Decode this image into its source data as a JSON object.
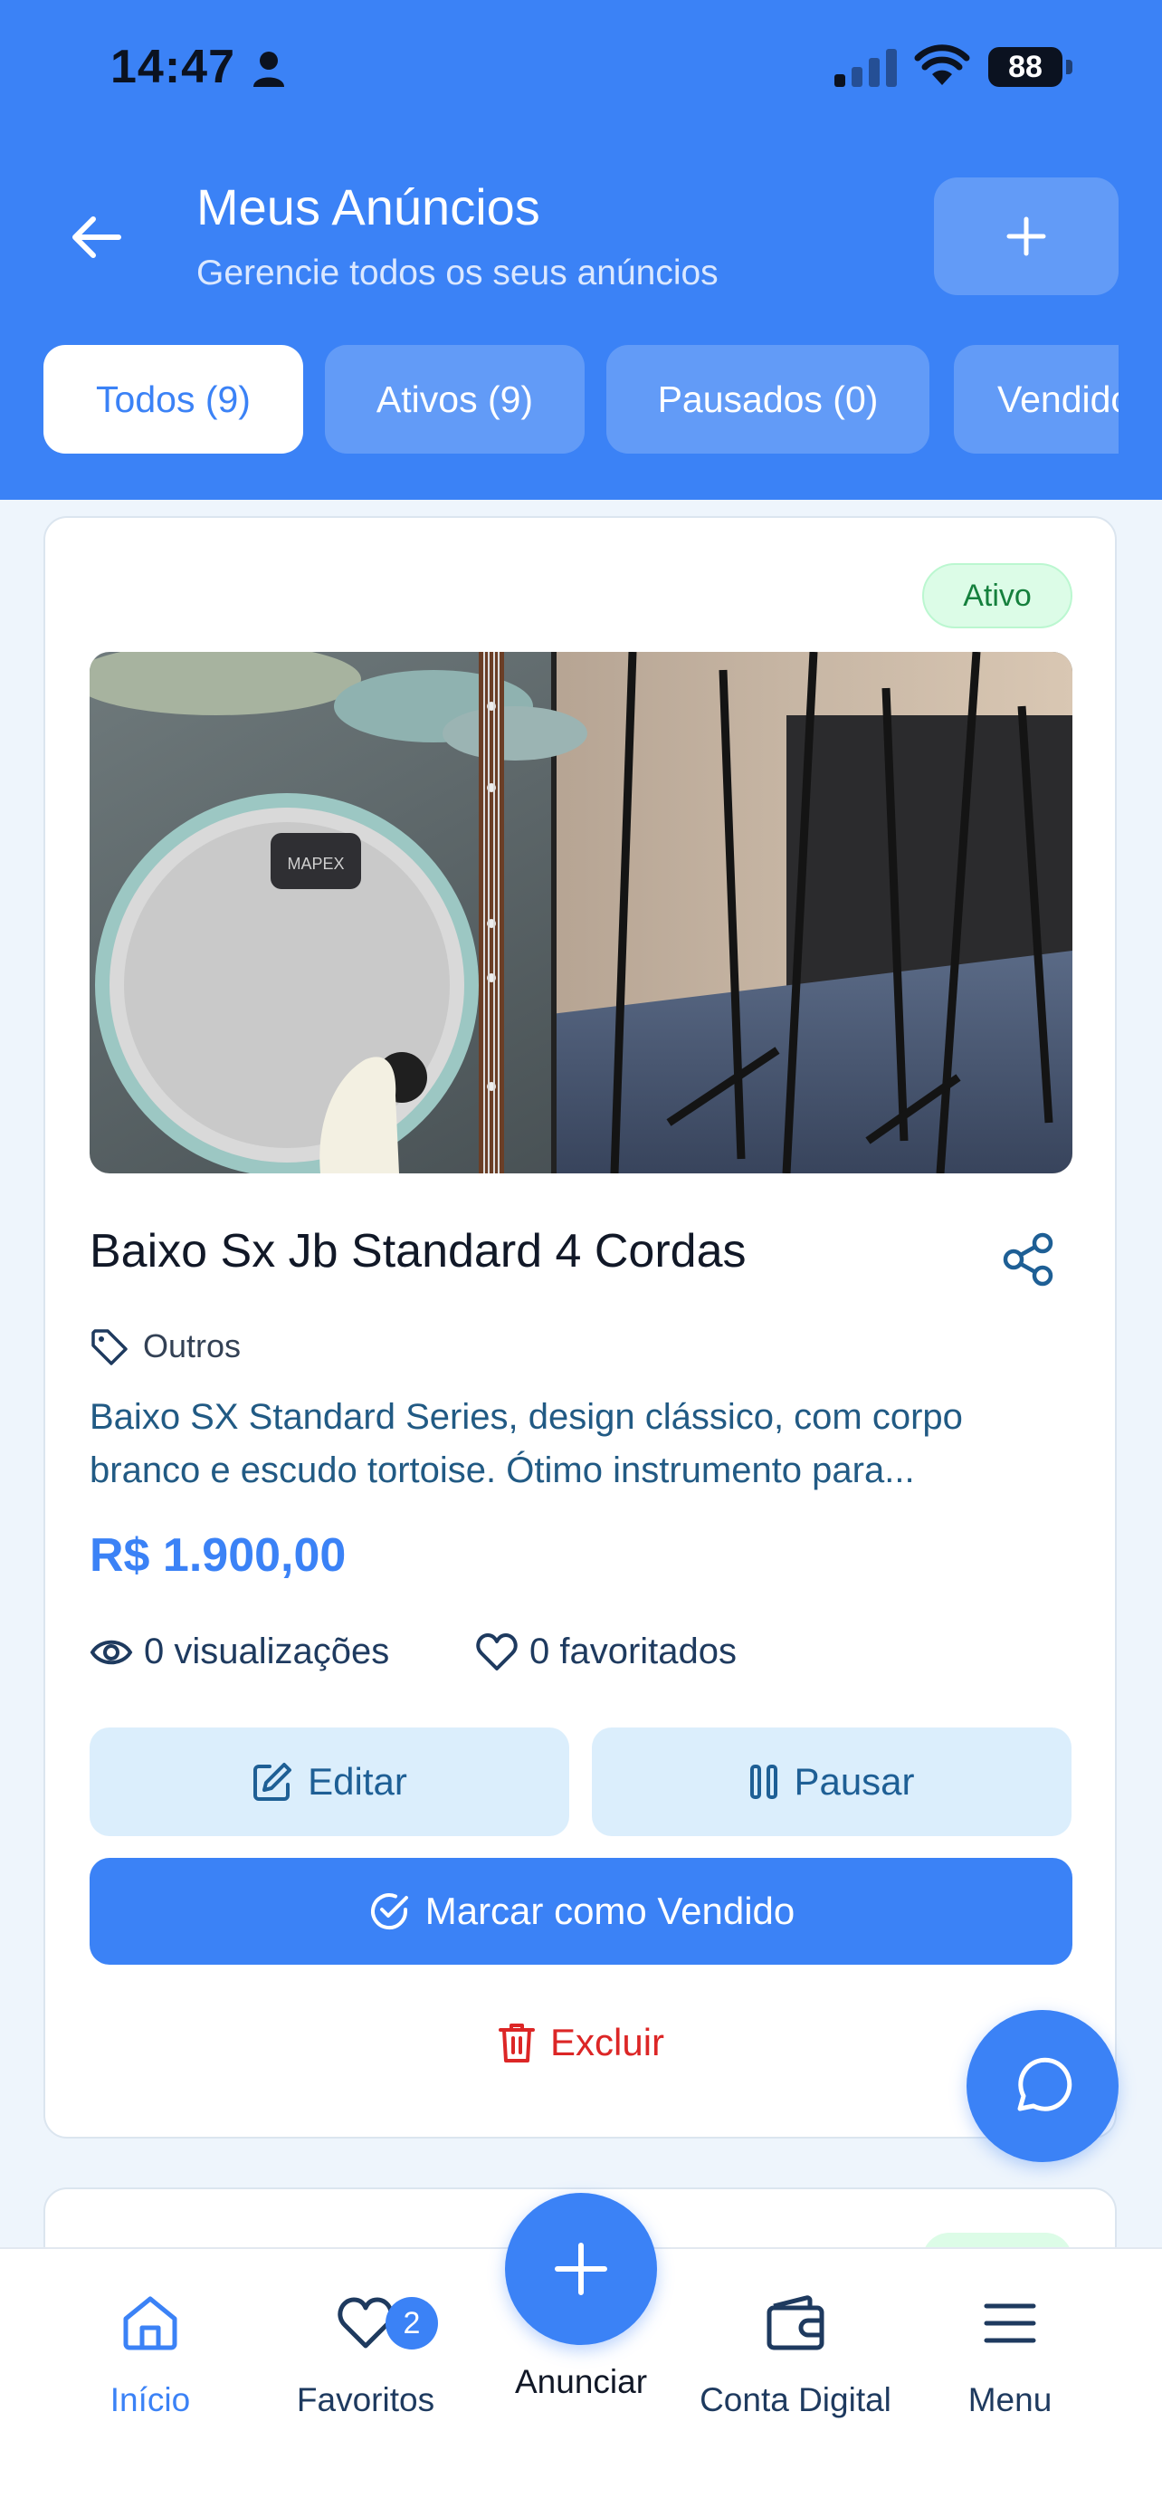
{
  "status_bar": {
    "time": "14:47",
    "battery": "88"
  },
  "header": {
    "title": "Meus Anúncios",
    "subtitle": "Gerencie todos os seus anúncios"
  },
  "tabs": [
    {
      "label": "Todos (9)",
      "active": true
    },
    {
      "label": "Ativos (9)",
      "active": false
    },
    {
      "label": "Pausados (0)",
      "active": false
    },
    {
      "label": "Vendidos",
      "active": false
    }
  ],
  "listing": {
    "status": "Ativo",
    "title": "Baixo Sx Jb Standard 4 Cordas",
    "category": "Outros",
    "description": "Baixo SX Standard Series, design clássico, com corpo branco e escudo tortoise. Ótimo instrumento para...",
    "price": "R$ 1.900,00",
    "views": "0 visualizações",
    "favorites": "0 favoritados",
    "photo_logo": "MAPEX"
  },
  "actions": {
    "edit": "Editar",
    "pause": "Pausar",
    "mark_sold": "Marcar como Vendido",
    "delete": "Excluir"
  },
  "bottom_nav": {
    "home": "Início",
    "favorites": "Favoritos",
    "favorites_count": "2",
    "announce": "Anunciar",
    "wallet": "Conta Digital",
    "menu": "Menu"
  },
  "colors": {
    "primary": "#3b82f6",
    "success": "#15803d",
    "danger": "#dc2626"
  }
}
